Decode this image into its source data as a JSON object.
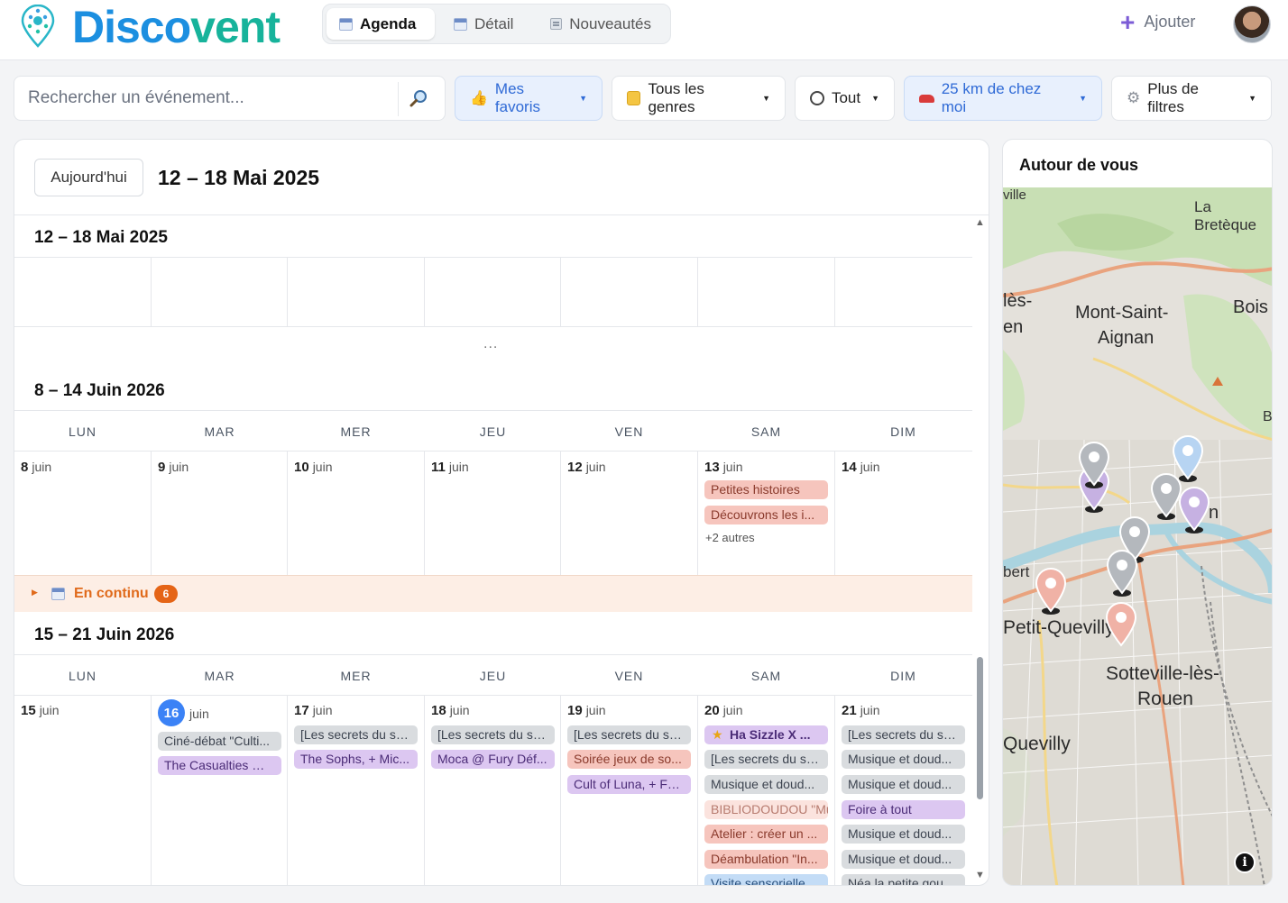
{
  "app": {
    "brand": "Discovent",
    "tabs": [
      {
        "label": "Agenda",
        "icon": "calendar-icon",
        "active": true
      },
      {
        "label": "Détail",
        "icon": "calendar-icon",
        "active": false
      },
      {
        "label": "Nouveautés",
        "icon": "news-icon",
        "active": false
      }
    ],
    "add_label": "Ajouter"
  },
  "filters": {
    "search_placeholder": "Rechercher un événement...",
    "favorites": "Mes favoris",
    "genres": "Tous les genres",
    "time": "Tout",
    "distance": "25 km de chez moi",
    "more": "Plus de filtres"
  },
  "calendar": {
    "today_button": "Aujourd'hui",
    "range_title": "12 – 18 Mai 2025",
    "week0_title": "12 – 18 Mai 2025",
    "ellipsis": "...",
    "week1_title": "8 – 14 Juin 2026",
    "week2_title": "15 – 21 Juin 2026",
    "dow": [
      "LUN",
      "MAR",
      "MER",
      "JEU",
      "VEN",
      "SAM",
      "DIM"
    ],
    "month": "juin",
    "week1_days": [
      "8",
      "9",
      "10",
      "11",
      "12",
      "13",
      "14"
    ],
    "week1_sat_events": [
      "Petites histoires",
      "Découvrons les i..."
    ],
    "week1_sat_more": "+2 autres",
    "continu_label": "En continu",
    "continu_count": "6",
    "week2_days": [
      "15",
      "16",
      "17",
      "18",
      "19",
      "20",
      "21"
    ],
    "week2_events": {
      "tue": [
        "Ciné-débat \"Culti...",
        "The Casualties @..."
      ],
      "wed": [
        "[Les secrets du so...",
        "The Sophs, + Mic..."
      ],
      "thu": [
        "[Les secrets du so...",
        "Moca @ Fury Déf..."
      ],
      "fri": [
        "[Les secrets du so...",
        "Soirée jeux de so...",
        "Cult of Luna, + Fa..."
      ],
      "sat": [
        "Ha Sizzle X ...",
        "[Les secrets du so...",
        "Musique et doud...",
        "BIBLIODOUDOU \"Mu",
        "Atelier : créer un ...",
        "Déambulation \"In...",
        "Visite sensorielle ..."
      ],
      "sun": [
        "[Les secrets du so...",
        "Musique et doud...",
        "Musique et doud...",
        "Foire à tout",
        "Musique et doud...",
        "Musique et doud...",
        "Néa la petite gou..."
      ]
    }
  },
  "map": {
    "title": "Autour de vous",
    "labels": [
      "La Bretèque",
      "Mont-Saint-",
      "Aignan",
      "Bois",
      "lès-",
      "en",
      "Bi",
      "ville",
      "bert",
      "Petit-Quevilly",
      "Sotteville-lès-",
      "Rouen",
      "Quevilly",
      "n"
    ],
    "info": "i"
  },
  "colors": {
    "brand_blue": "#1a93de",
    "brand_green": "#17b39b",
    "accent_orange": "#e56416",
    "today_blue": "#3b82f6"
  }
}
